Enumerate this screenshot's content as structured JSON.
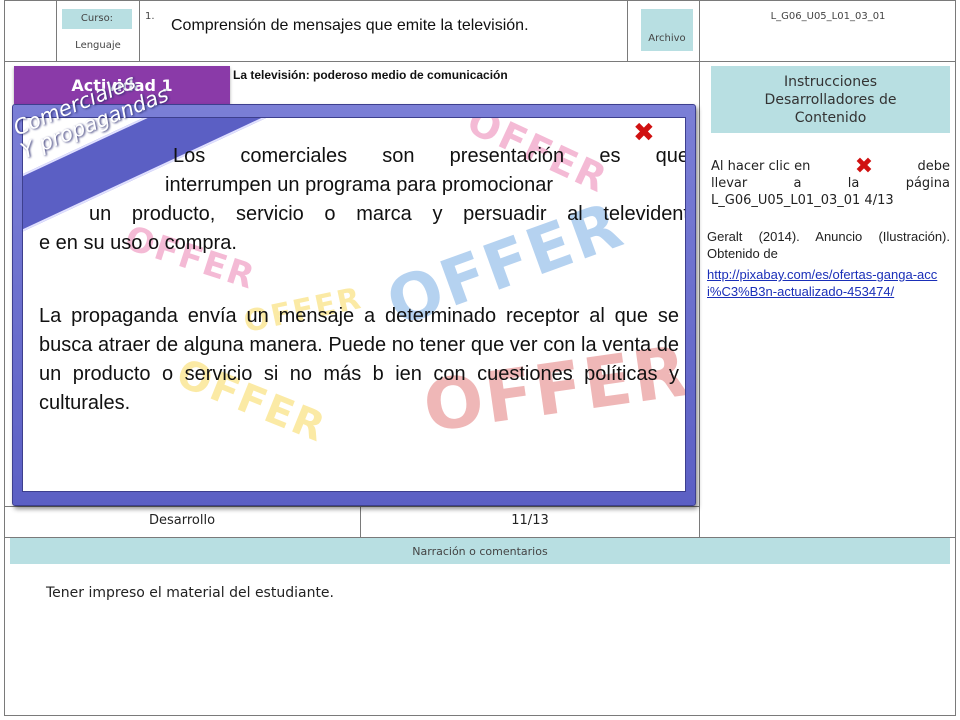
{
  "header": {
    "course_label": "Curso:",
    "course_value": "Lenguaje",
    "step_number": "1.",
    "title": "Comprensión de mensajes que emite la televisión.",
    "file_label": "Archivo",
    "file_code": "L_G06_U05_L01_03_01"
  },
  "activity": {
    "tab_label": "Actividad 1",
    "subtitle": "La televisión: poderoso medio de comunicación"
  },
  "popup": {
    "ribbon_line1": "Comerciales",
    "ribbon_line2": "Y propagandas",
    "paragraph1_line1": "Los comerciales son presentación es que",
    "paragraph1_line2": "interrumpen un programa para promocionar",
    "paragraph1_line3": "un producto, servicio o marca y persuadir al televident",
    "paragraph1_line4": "e en su uso o compra.",
    "paragraph2": "La propaganda envía un mensaje a determinado receptor al que se busca atraer de alguna manera. Puede no tener que ver con la venta de un producto o servicio si no más b ien con cuestiones políticas y culturales.",
    "watermark_words": [
      "OFFER",
      "OFFER",
      "OFFER",
      "OFFER",
      "OFFER",
      "OFFER"
    ]
  },
  "footer_row": {
    "left": "Desarrollo",
    "right": "11/13"
  },
  "side": {
    "instructions_title": "Instrucciones Desarrolladores de Contenido",
    "click_text_before": "Al hacer clic en",
    "click_text_after": "debe llevar a la página L_G06_U05_L01_03_01 4/13",
    "credit_text": "Geralt (2014). Anuncio (Ilustración). Obtenido de",
    "credit_link": "http://pixabay.com/es/ofertas-ganga-acci%C3%B3n-actualizado-453474/"
  },
  "narration": {
    "bar_label": "Narración o comentarios",
    "text": "Tener impreso el material del estudiante."
  },
  "colors": {
    "accent_purple": "#8a3aa8",
    "popup_blue": "#5b5fc4",
    "label_cyan": "#b8dfe2",
    "close_red": "#d01010"
  }
}
